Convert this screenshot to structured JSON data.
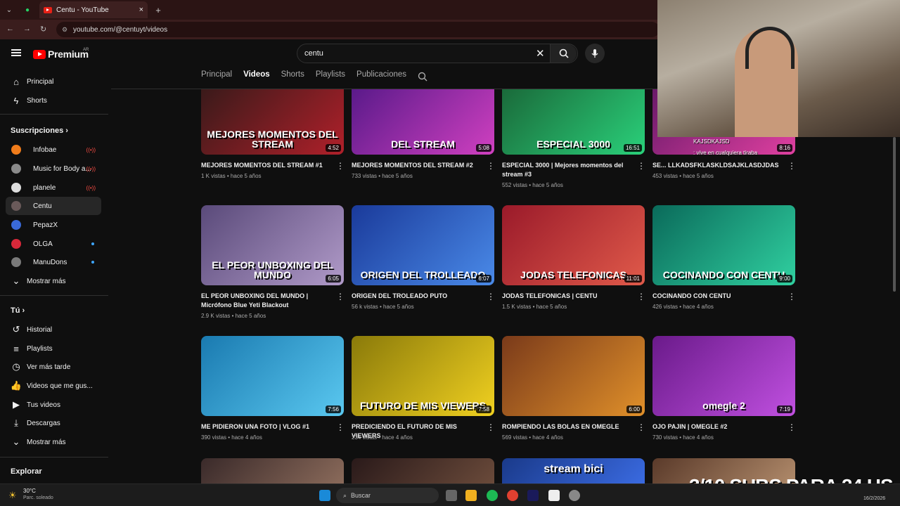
{
  "browser": {
    "tab_title": "Centu - YouTube",
    "url": "youtube.com/@centuyt/videos"
  },
  "header": {
    "logo": "Premium",
    "logo_region": "AR",
    "search_value": "centu"
  },
  "channel_tabs": [
    "Principal",
    "Videos",
    "Shorts",
    "Playlists",
    "Publicaciones"
  ],
  "sidebar": {
    "main": [
      {
        "label": "Principal",
        "icon": "home-icon"
      },
      {
        "label": "Shorts",
        "icon": "shorts-icon"
      }
    ],
    "subs_heading": "Suscripciones",
    "subs": [
      {
        "label": "Infobae",
        "color": "#f07c1b",
        "badge": "live"
      },
      {
        "label": "Music for Body a...",
        "color": "#8a8a8a",
        "badge": "live"
      },
      {
        "label": "planele",
        "color": "#dddddd",
        "badge": "live"
      },
      {
        "label": "Centu",
        "color": "#6a5a5a",
        "badge": ""
      },
      {
        "label": "PepazX",
        "color": "#3a6ad8",
        "badge": ""
      },
      {
        "label": "OLGA",
        "color": "#d8283a",
        "badge": "dot"
      },
      {
        "label": "ManuDons",
        "color": "#7a7a7a",
        "badge": "dot"
      }
    ],
    "show_more": "Mostrar más",
    "you_heading": "Tú",
    "you": [
      {
        "label": "Historial",
        "icon": "history-icon"
      },
      {
        "label": "Playlists",
        "icon": "playlist-icon"
      },
      {
        "label": "Ver más tarde",
        "icon": "watch-later-icon"
      },
      {
        "label": "Videos que me gus...",
        "icon": "like-icon"
      },
      {
        "label": "Tus videos",
        "icon": "your-videos-icon"
      },
      {
        "label": "Descargas",
        "icon": "download-icon"
      }
    ],
    "show_more_2": "Mostrar más",
    "explore_heading": "Explorar"
  },
  "videos": [
    {
      "title": "MEJORES MOMENTOS DEL STREAM #1",
      "meta": "1 K vistas • hace 5 años",
      "duration": "4:52",
      "thumb_text": "MEJORES MOMENTOS DEL STREAM",
      "bg": "linear-gradient(135deg,#3a1a1a,#b0202a)"
    },
    {
      "title": "MEJORES MOMENTOS DEL STREAM #2",
      "meta": "733 vistas • hace 5 años",
      "duration": "5:08",
      "thumb_text": "DEL STREAM",
      "bg": "linear-gradient(135deg,#5a1a8a,#d040c0)"
    },
    {
      "title": "ESPECIAL 3000 | Mejores momentos del stream #3",
      "meta": "552 vistas • hace 5 años",
      "duration": "16:51",
      "thumb_text": "ESPECIAL 3000",
      "bg": "linear-gradient(135deg,#1a6a3a,#2ad07a)"
    },
    {
      "title": "SE... LLKADSFKLASKLDSAJKLASDJDAS",
      "meta": "453 vistas • hace 5 años",
      "duration": "8:16",
      "thumb_text": "",
      "bg": "linear-gradient(135deg,#6a1a6a,#e040a0)"
    },
    {
      "title": "EL PEOR UNBOXING DEL MUNDO | Micrófono Blue Yeti Blackout",
      "meta": "2.9 K vistas • hace 5 años",
      "duration": "6:05",
      "thumb_text": "EL PEOR UNBOXING DEL MUNDO",
      "bg": "linear-gradient(135deg,#5a4a7a,#b09ac8)"
    },
    {
      "title": "ORIGEN DEL TROLEADO PUTO",
      "meta": "56 k vistas • hace 5 años",
      "duration": "6:07",
      "thumb_text": "ORIGEN DEL TROLLEADO",
      "bg": "linear-gradient(135deg,#1a3a9a,#4a8ae8)"
    },
    {
      "title": "JODAS TELEFONICAS | CENTU",
      "meta": "1.5 K vistas • hace 5 años",
      "duration": "11:01",
      "thumb_text": "JODAS TELEFONICAS",
      "bg": "linear-gradient(135deg,#9a1a2a,#e05a4a)"
    },
    {
      "title": "COCINANDO CON CENTU",
      "meta": "426 vistas • hace 4 años",
      "duration": "9:00",
      "thumb_text": "COCINANDO CON CENTU",
      "bg": "linear-gradient(135deg,#0a6a5a,#30d0a0)"
    },
    {
      "title": "ME PIDIERON UNA FOTO | VLOG #1",
      "meta": "390 vistas • hace 4 años",
      "duration": "7:56",
      "thumb_text": "",
      "bg": "linear-gradient(135deg,#1a7ab0,#5ac8f0)"
    },
    {
      "title": "PREDICIENDO EL FUTURO DE MIS VIEWERS",
      "meta": "234 vistas • hace 4 años",
      "duration": "7:58",
      "thumb_text": "FUTURO DE MIS VIEWERS",
      "bg": "linear-gradient(135deg,#8a7a0a,#f0d020)"
    },
    {
      "title": "ROMPIENDO LAS BOLAS EN OMEGLE",
      "meta": "569 vistas • hace 4 años",
      "duration": "6:00",
      "thumb_text": "",
      "bg": "linear-gradient(135deg,#7a3a1a,#e0902a)"
    },
    {
      "title": "OJO PAJIN | OMEGLE #2",
      "meta": "730 vistas • hace 4 años",
      "duration": "7:19",
      "thumb_text": "omegle 2",
      "bg": "linear-gradient(135deg,#6a1a8a,#c050e0)"
    },
    {
      "title": "",
      "meta": "",
      "duration": "",
      "thumb_text": "",
      "bg": "linear-gradient(135deg,#3a2a2a,#8a6a5a)"
    },
    {
      "title": "",
      "meta": "",
      "duration": "",
      "thumb_text": "",
      "bg": "linear-gradient(135deg,#2a1a1a,#6a4a3a)"
    },
    {
      "title": "",
      "meta": "",
      "duration": "",
      "thumb_text": "stream bici",
      "bg": "linear-gradient(135deg,#1a3a8a,#3a6ae0)"
    },
    {
      "title": "",
      "meta": "",
      "duration": "",
      "thumb_text": "",
      "bg": "linear-gradient(135deg,#5a3a2a,#b08a6a)"
    }
  ],
  "stream_overlay": {
    "chat_user": "KAJSDKAJSD",
    "chat_msg": ": vive en cualquiera tiraba",
    "goal": "3/10 SUBS PARA 24 HS"
  },
  "taskbar": {
    "weather_temp": "30°C",
    "weather_desc": "Parc. soleado",
    "search": "Buscar",
    "date": "16/2/2026"
  }
}
